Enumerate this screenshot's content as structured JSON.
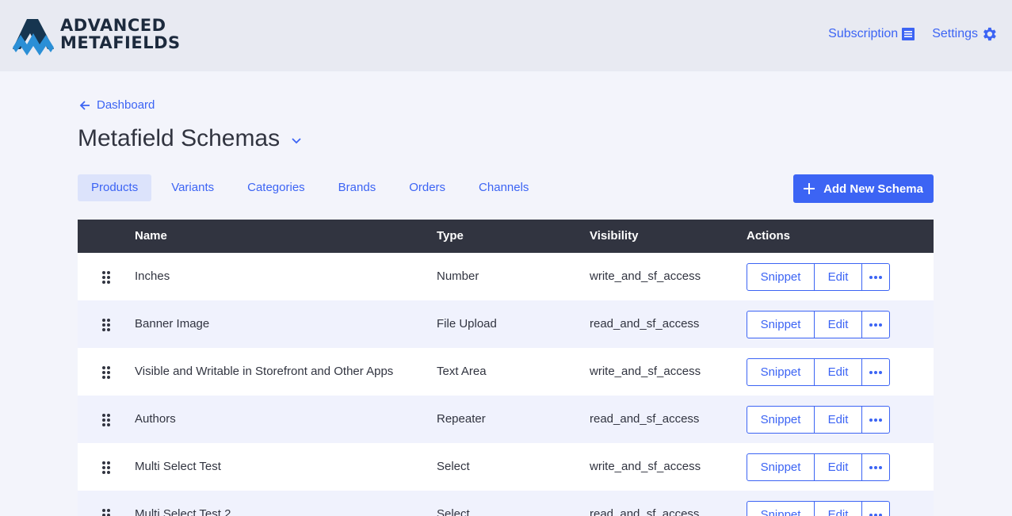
{
  "header": {
    "logo_line1": "ADVANCED",
    "logo_line2": "METAFIELDS",
    "nav": [
      {
        "label": "Subscription",
        "icon": "receipt-icon"
      },
      {
        "label": "Settings",
        "icon": "gear-icon"
      }
    ]
  },
  "breadcrumb": {
    "back_label": "Dashboard"
  },
  "page": {
    "title": "Metafield Schemas"
  },
  "tabs": [
    {
      "label": "Products",
      "active": true
    },
    {
      "label": "Variants"
    },
    {
      "label": "Categories"
    },
    {
      "label": "Brands"
    },
    {
      "label": "Orders"
    },
    {
      "label": "Channels"
    }
  ],
  "add_button": {
    "label": "Add New Schema"
  },
  "table": {
    "columns": [
      "Name",
      "Type",
      "Visibility",
      "Actions"
    ],
    "action_labels": {
      "snippet": "Snippet",
      "edit": "Edit"
    },
    "rows": [
      {
        "name": "Inches",
        "type": "Number",
        "visibility": "write_and_sf_access"
      },
      {
        "name": "Banner Image",
        "type": "File Upload",
        "visibility": "read_and_sf_access"
      },
      {
        "name": "Visible and Writable in Storefront and Other Apps",
        "type": "Text Area",
        "visibility": "write_and_sf_access"
      },
      {
        "name": "Authors",
        "type": "Repeater",
        "visibility": "read_and_sf_access"
      },
      {
        "name": "Multi Select Test",
        "type": "Select",
        "visibility": "write_and_sf_access"
      },
      {
        "name": "Multi Select Test 2",
        "type": "Select",
        "visibility": "read_and_sf_access"
      }
    ]
  },
  "colors": {
    "accent": "#3c64f4",
    "header_bg": "#e8eaf2",
    "table_head": "#313440"
  }
}
